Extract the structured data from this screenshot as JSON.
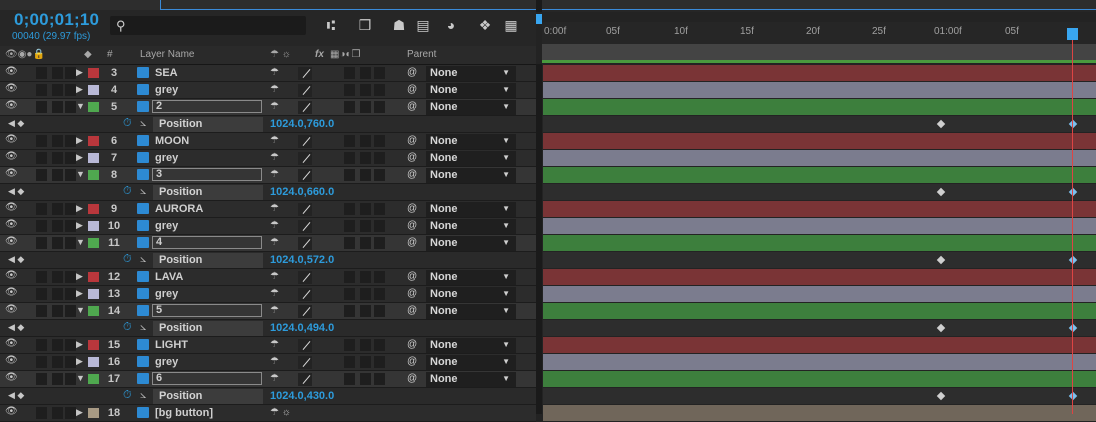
{
  "header": {
    "timecode": "0;00;01;10",
    "frame_info": "00040 (29.97 fps)",
    "search_icon": "search-icon"
  },
  "columns": {
    "hash": "#",
    "layer_name": "Layer Name",
    "fx": "fx",
    "parent": "Parent"
  },
  "ruler": {
    "ticks": [
      "0:00f",
      "05f",
      "10f",
      "15f",
      "20f",
      "25f",
      "01:00f",
      "05f"
    ]
  },
  "layers": [
    {
      "num": "3",
      "name": "SEA",
      "color": "#b9373c",
      "parent": "None",
      "bar": "red"
    },
    {
      "num": "4",
      "name": "grey",
      "color": "#b8b8d6",
      "parent": "None",
      "bar": "lav"
    },
    {
      "num": "5",
      "name": "2",
      "color": "#4fa84f",
      "parent": "None",
      "bar": "grn",
      "open": true,
      "prop": {
        "name": "Position",
        "value": "1024.0,760.0"
      }
    },
    {
      "num": "6",
      "name": "MOON",
      "color": "#b9373c",
      "parent": "None",
      "bar": "red"
    },
    {
      "num": "7",
      "name": "grey",
      "color": "#b8b8d6",
      "parent": "None",
      "bar": "lav"
    },
    {
      "num": "8",
      "name": "3",
      "color": "#4fa84f",
      "parent": "None",
      "bar": "grn",
      "open": true,
      "prop": {
        "name": "Position",
        "value": "1024.0,660.0"
      }
    },
    {
      "num": "9",
      "name": "AURORA",
      "color": "#b9373c",
      "parent": "None",
      "bar": "red"
    },
    {
      "num": "10",
      "name": "grey",
      "color": "#b8b8d6",
      "parent": "None",
      "bar": "lav"
    },
    {
      "num": "11",
      "name": "4",
      "color": "#4fa84f",
      "parent": "None",
      "bar": "grn",
      "open": true,
      "prop": {
        "name": "Position",
        "value": "1024.0,572.0"
      }
    },
    {
      "num": "12",
      "name": "LAVA",
      "color": "#b9373c",
      "parent": "None",
      "bar": "red"
    },
    {
      "num": "13",
      "name": "grey",
      "color": "#b8b8d6",
      "parent": "None",
      "bar": "lav"
    },
    {
      "num": "14",
      "name": "5",
      "color": "#4fa84f",
      "parent": "None",
      "bar": "grn",
      "open": true,
      "prop": {
        "name": "Position",
        "value": "1024.0,494.0"
      }
    },
    {
      "num": "15",
      "name": "LIGHT",
      "color": "#b9373c",
      "parent": "None",
      "bar": "red"
    },
    {
      "num": "16",
      "name": "grey",
      "color": "#b8b8d6",
      "parent": "None",
      "bar": "lav"
    },
    {
      "num": "17",
      "name": "6",
      "color": "#4fa84f",
      "parent": "None",
      "bar": "grn",
      "open": true,
      "prop": {
        "name": "Position",
        "value": "1024.0,430.0"
      }
    },
    {
      "num": "18",
      "name": "[bg button]",
      "color": "#a89a84",
      "parent": "",
      "bar": "tan"
    }
  ]
}
